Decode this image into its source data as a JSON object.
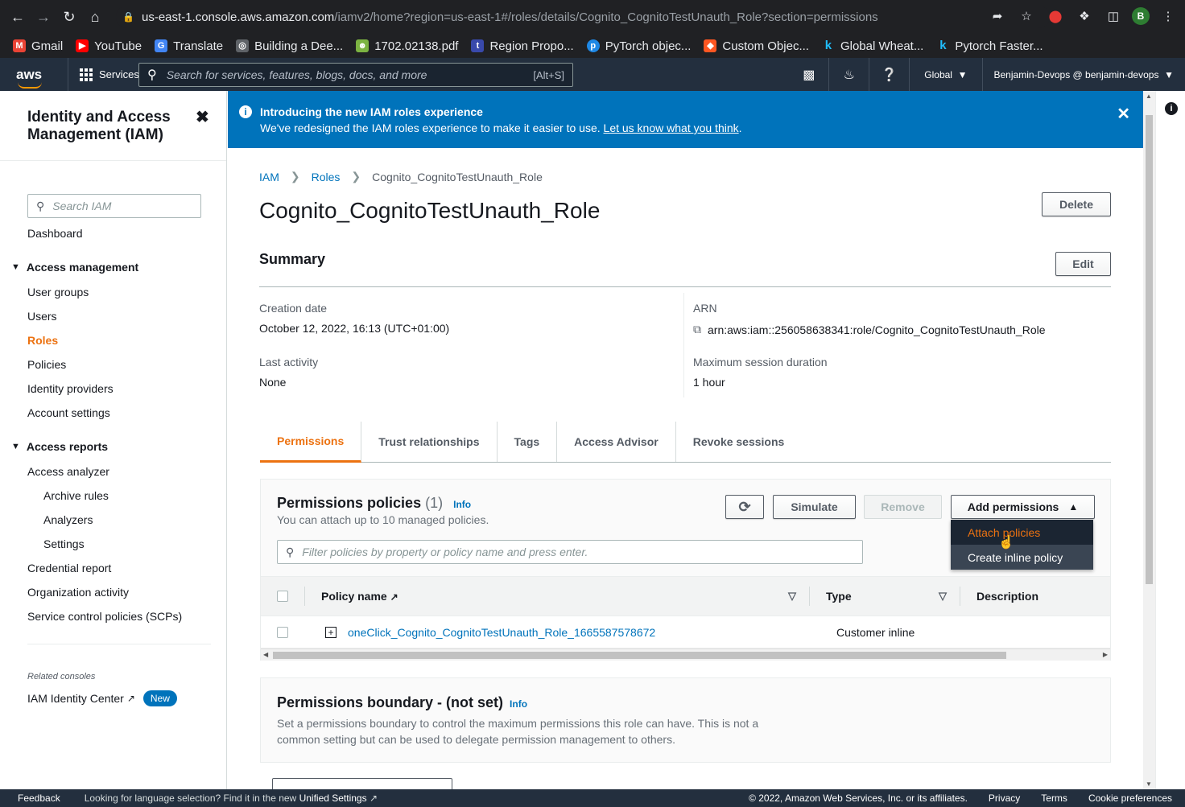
{
  "browser": {
    "url_host": "us-east-1.console.aws.amazon.com",
    "url_path": "/iamv2/home?region=us-east-1#/roles/details/Cognito_CognitoTestUnauth_Role?section=permissions",
    "profile_initial": "B",
    "bookmarks": [
      {
        "label": "Gmail",
        "color": "#ea4335"
      },
      {
        "label": "YouTube",
        "color": "#ff0000"
      },
      {
        "label": "Translate",
        "color": "#4285f4"
      },
      {
        "label": "Building a Dee...",
        "color": "#5f6368"
      },
      {
        "label": "1702.02138.pdf",
        "color": "#7cb342"
      },
      {
        "label": "Region Propo...",
        "color": "#3949ab"
      },
      {
        "label": "PyTorch objec...",
        "color": "#1e88e5"
      },
      {
        "label": "Custom Objec...",
        "color": "#ff5722"
      },
      {
        "label": "Global Wheat...",
        "color": "#20beff"
      },
      {
        "label": "Pytorch Faster...",
        "color": "#20beff"
      }
    ]
  },
  "aws_header": {
    "logo": "aws",
    "services_label": "Services",
    "search_placeholder": "Search for services, features, blogs, docs, and more",
    "search_shortcut": "[Alt+S]",
    "region": "Global",
    "account": "Benjamin-Devops @ benjamin-devops"
  },
  "sidebar": {
    "title": "Identity and Access Management (IAM)",
    "search_placeholder": "Search IAM",
    "dashboard": "Dashboard",
    "access_management": "Access management",
    "user_groups": "User groups",
    "users": "Users",
    "roles": "Roles",
    "policies": "Policies",
    "identity_providers": "Identity providers",
    "account_settings": "Account settings",
    "access_reports": "Access reports",
    "access_analyzer": "Access analyzer",
    "archive_rules": "Archive rules",
    "analyzers": "Analyzers",
    "settings": "Settings",
    "credential_report": "Credential report",
    "organization_activity": "Organization activity",
    "scps": "Service control policies (SCPs)",
    "related_consoles": "Related consoles",
    "identity_center": "IAM Identity Center",
    "new_badge": "New"
  },
  "banner": {
    "title": "Introducing the new IAM roles experience",
    "text": "We've redesigned the IAM roles experience to make it easier to use.",
    "link": "Let us know what you think",
    "period": "."
  },
  "breadcrumb": {
    "iam": "IAM",
    "roles": "Roles",
    "current": "Cognito_CognitoTestUnauth_Role"
  },
  "page_title": "Cognito_CognitoTestUnauth_Role",
  "delete_label": "Delete",
  "summary": {
    "title": "Summary",
    "edit_label": "Edit",
    "creation_date_label": "Creation date",
    "creation_date": "October 12, 2022, 16:13 (UTC+01:00)",
    "last_activity_label": "Last activity",
    "last_activity": "None",
    "arn_label": "ARN",
    "arn": "arn:aws:iam::256058638341:role/Cognito_CognitoTestUnauth_Role",
    "max_session_label": "Maximum session duration",
    "max_session": "1 hour"
  },
  "tabs": [
    "Permissions",
    "Trust relationships",
    "Tags",
    "Access Advisor",
    "Revoke sessions"
  ],
  "permissions": {
    "title": "Permissions policies",
    "count": "(1)",
    "info": "Info",
    "subtitle": "You can attach up to 10 managed policies.",
    "simulate": "Simulate",
    "remove": "Remove",
    "add_permissions": "Add permissions",
    "filter_placeholder": "Filter policies by property or policy name and press enter.",
    "columns": {
      "policy_name": "Policy name",
      "type": "Type",
      "description": "Description"
    },
    "rows": [
      {
        "name": "oneClick_Cognito_CognitoTestUnauth_Role_1665587578672",
        "type": "Customer inline"
      }
    ],
    "dropdown": [
      "Attach policies",
      "Create inline policy"
    ]
  },
  "boundary": {
    "title": "Permissions boundary - (not set)",
    "info": "Info",
    "text": "Set a permissions boundary to control the maximum permissions this role can have. This is not a common setting but can be used to delegate permission management to others."
  },
  "footer": {
    "feedback": "Feedback",
    "lang_text": "Looking for language selection? Find it in the new",
    "unified": "Unified Settings",
    "copyright": "© 2022, Amazon Web Services, Inc. or its affiliates.",
    "privacy": "Privacy",
    "terms": "Terms",
    "cookies": "Cookie preferences"
  }
}
